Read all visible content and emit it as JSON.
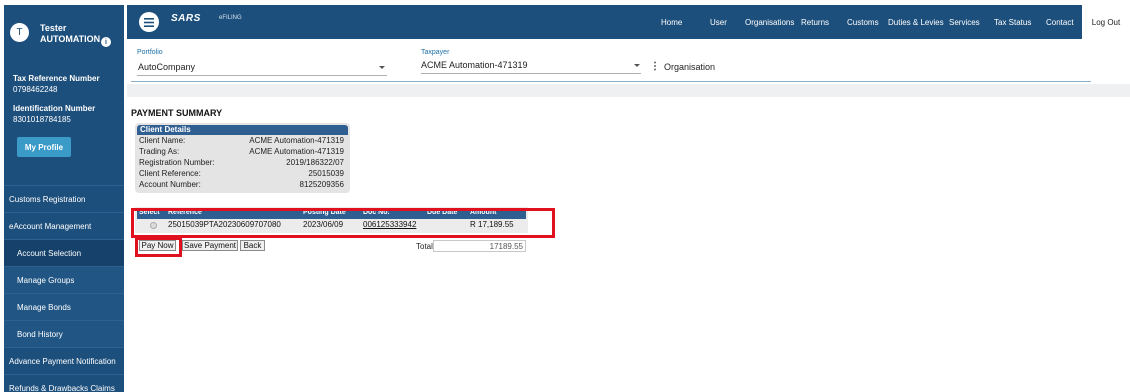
{
  "user": {
    "avatar_initial": "T",
    "first_name": "Tester",
    "last_name": "AUTOMATION",
    "info_icon": "i",
    "tax_ref_label": "Tax Reference Number",
    "tax_ref_value": "0798462248",
    "id_label": "Identification Number",
    "id_value": "8301018784185",
    "profile_button": "My Profile"
  },
  "sidebar": {
    "items": [
      {
        "label": "Customs Registration"
      },
      {
        "label": "eAccount Management"
      },
      {
        "label": "Account Selection"
      },
      {
        "label": "Manage Groups"
      },
      {
        "label": "Manage Bonds"
      },
      {
        "label": "Bond History"
      },
      {
        "label": "Advance Payment Notification"
      },
      {
        "label": "Refunds & Drawbacks Claims"
      }
    ]
  },
  "topbar": {
    "logo_text": "SARS",
    "logo_sub": "eFILING",
    "nav": [
      "Home",
      "User",
      "Organisations",
      "Returns",
      "Customs",
      "Duties & Levies",
      "Services",
      "Tax Status",
      "Contact"
    ],
    "logout": "Log Out"
  },
  "filters": {
    "portfolio_label": "Portfolio",
    "portfolio_value": "AutoCompany",
    "taxpayer_label": "Taxpayer",
    "taxpayer_value": "ACME Automation-471319",
    "organisation_label": "Organisation"
  },
  "payment_summary": {
    "title": "PAYMENT SUMMARY",
    "client_details": {
      "header": "Client Details",
      "rows": [
        {
          "key": "Client Name:",
          "value": "ACME Automation-471319"
        },
        {
          "key": "Trading As:",
          "value": "ACME Automation-471319"
        },
        {
          "key": "Registration Number:",
          "value": "2019/186322/07"
        },
        {
          "key": "Client Reference:",
          "value": "25015039"
        },
        {
          "key": "Account Number:",
          "value": "8125209356"
        }
      ]
    },
    "table": {
      "headers": [
        "Select",
        "Reference",
        "Posting Date",
        "Doc No.",
        "Due Date",
        "Amount"
      ],
      "row": {
        "reference": "25015039PTA20230609707080",
        "posting_date": "2023/06/09",
        "doc_no": "006125333942",
        "due_date": "",
        "amount": "R 17,189.55"
      }
    },
    "buttons": {
      "pay_now": "Pay Now",
      "save_payment": "Save Payment",
      "back": "Back"
    },
    "total_label": "Total",
    "total_value": "17189.55"
  },
  "colors": {
    "brand_blue": "#1d4f7c",
    "header_blue": "#2f5f91",
    "highlight_red": "#e0101e"
  }
}
